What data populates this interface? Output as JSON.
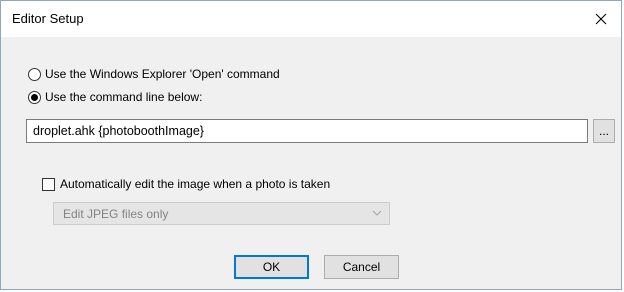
{
  "window": {
    "title": "Editor Setup"
  },
  "options": {
    "explorer_open_label": "Use the Windows Explorer 'Open' command",
    "command_line_label": "Use the command line below:",
    "selected": "command_line"
  },
  "command": {
    "value": "droplet.ahk {photoboothImage}",
    "browse_label": "..."
  },
  "auto_edit": {
    "label": "Automatically edit the image when a photo is taken",
    "checked": false,
    "select_value": "Edit JPEG files only",
    "select_enabled": false
  },
  "buttons": {
    "ok_label": "OK",
    "cancel_label": "Cancel"
  },
  "colors": {
    "accent": "#0078d7",
    "dialog_bg": "#f0f0f0",
    "disabled_text": "#838383"
  },
  "icons": {
    "close": "close-icon",
    "dropdown": "chevron-down-icon"
  }
}
